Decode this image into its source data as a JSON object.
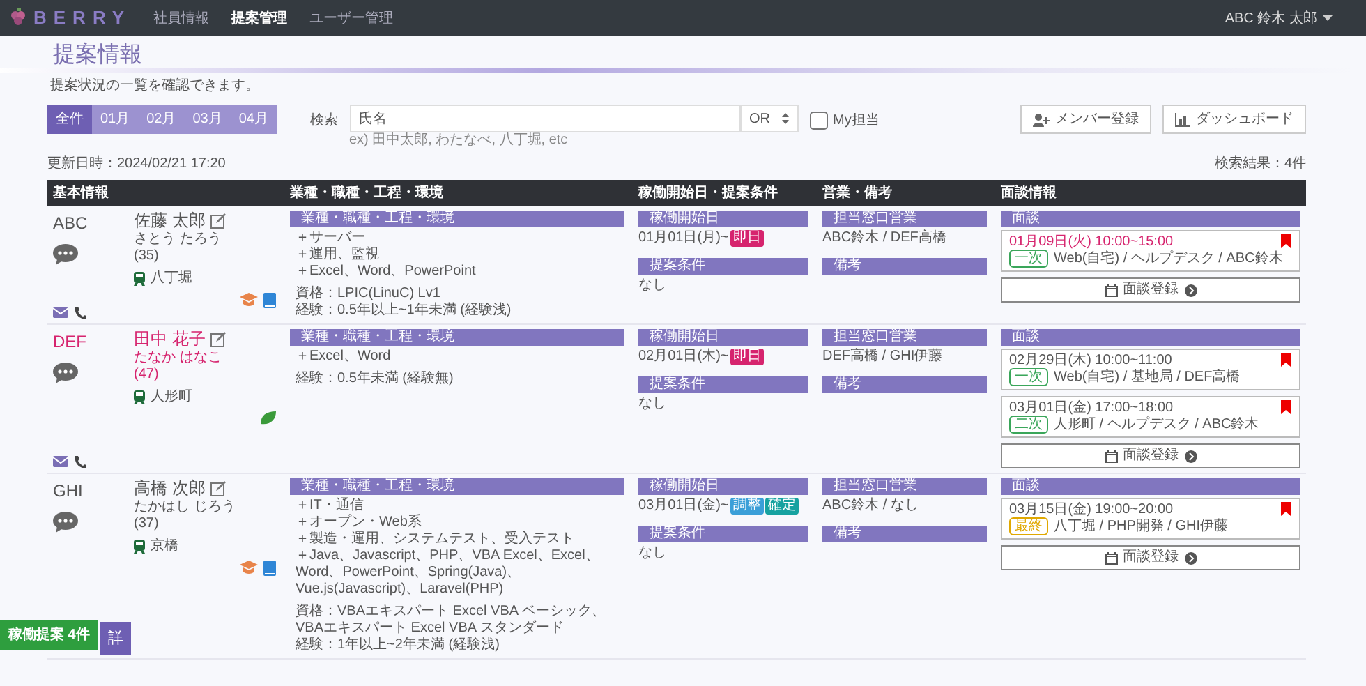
{
  "navbar": {
    "brand": "BERRY",
    "links": [
      {
        "label": "社員情報",
        "selected": false
      },
      {
        "label": "提案管理",
        "selected": true
      },
      {
        "label": "ユーザー管理",
        "selected": false
      }
    ],
    "user": "ABC 鈴木 太郎"
  },
  "page": {
    "title": "提案情報",
    "subtitle": "提案状況の一覧を確認できます。"
  },
  "filters": {
    "months": [
      {
        "label": "全件",
        "selected": true
      },
      {
        "label": "01月",
        "selected": false
      },
      {
        "label": "02月",
        "selected": false
      },
      {
        "label": "03月",
        "selected": false
      },
      {
        "label": "04月",
        "selected": false
      }
    ],
    "search_label": "検索",
    "search": {
      "value": "氏名"
    },
    "operator": "OR",
    "hint": "ex) 田中太郎, わたなべ, 八丁堀, etc",
    "my_only": {
      "label": "My担当",
      "checked": false
    }
  },
  "actions": [
    {
      "label": "メンバー登録",
      "kind": "user"
    },
    {
      "label": "ダッシュボード",
      "kind": "chart"
    }
  ],
  "updated": "更新日時：2024/02/21 17:20",
  "result_count": "検索結果：4件",
  "table": {
    "columns": [
      "基本情報",
      "業種・職種・工程・環境",
      "稼働開始日・提案条件",
      "営業・備考",
      "面談情報"
    ],
    "rows": [
      {
        "code": "ABC",
        "highlight": false,
        "name": "佐藤 太郎",
        "kana": "さとう たろう",
        "age": "(35)",
        "station": "八丁堀",
        "badges": [
          {
            "kind": "cap"
          },
          {
            "kind": "book"
          }
        ],
        "contact": true,
        "skills_label": "業種・職種・工程・環境",
        "skills": [
          "＋サーバー",
          "＋運用、監視",
          "＋Excel、Word、PowerPoint"
        ],
        "notes": [
          {
            "text": "資格：LPIC(LinuC) Lv1"
          },
          {
            "text": "経験：0.5年以上~1年未満",
            "tag": "(経験浅)"
          }
        ],
        "start_label": "稼働開始日",
        "start": "01月01日(月)~",
        "start_tags": [
          {
            "label": "即日",
            "color": "#d6246e"
          }
        ],
        "conditions_label": "提案条件",
        "conditions": "なし",
        "sales_label": "担当窓口営業",
        "sales": "ABC鈴木 / DEF高橋",
        "remarks_label": "備考",
        "interview_label": "面談",
        "interviews": [
          {
            "when": "01月09日(火) 10:00~15:00",
            "urgent": true,
            "stage": {
              "label": "一次",
              "color": "#3aa65a"
            },
            "detail": "Web(自宅) / ヘルプデスク / ABC鈴木",
            "flagged": true
          }
        ],
        "register": "面談登録"
      },
      {
        "code": "DEF",
        "highlight": true,
        "name": "田中 花子",
        "kana": "たなか はなこ",
        "age": "(47)",
        "station": "人形町",
        "badges": [
          {
            "kind": "leaf"
          }
        ],
        "contact": true,
        "skills_label": "業種・職種・工程・環境",
        "skills": [
          "＋Excel、Word"
        ],
        "notes": [
          {
            "text": "経験：0.5年未満",
            "tag": "(経験無)"
          }
        ],
        "start_label": "稼働開始日",
        "start": "02月01日(木)~",
        "start_tags": [
          {
            "label": "即日",
            "color": "#d6246e"
          }
        ],
        "conditions_label": "提案条件",
        "conditions": "なし",
        "sales_label": "担当窓口営業",
        "sales": "DEF高橋 / GHI伊藤",
        "remarks_label": "備考",
        "interview_label": "面談",
        "interviews": [
          {
            "when": "02月29日(木) 10:00~11:00",
            "urgent": false,
            "stage": {
              "label": "一次",
              "color": "#3aa65a"
            },
            "detail": "Web(自宅) / 基地局 / DEF高橋",
            "flagged": true
          },
          {
            "when": "03月01日(金) 17:00~18:00",
            "urgent": false,
            "stage": {
              "label": "二次",
              "color": "#3aa65a"
            },
            "detail": "人形町 / ヘルプデスク / ABC鈴木",
            "flagged": true
          }
        ],
        "register": "面談登録"
      },
      {
        "code": "GHI",
        "highlight": false,
        "name": "高橋 次郎",
        "kana": "たかはし じろう",
        "age": "(37)",
        "station": "京橋",
        "badges": [
          {
            "kind": "cap"
          },
          {
            "kind": "book"
          }
        ],
        "contact": false,
        "skills_label": "業種・職種・工程・環境",
        "skills": [
          "＋IT・通信",
          "＋オープン・Web系",
          "＋製造・運用、システムテスト、受入テスト",
          "＋Java、Javascript、PHP、VBA Excel、Excel、Word、PowerPoint、Spring(Java)、Vue.js(Javascript)、Laravel(PHP)"
        ],
        "notes": [
          {
            "text": "資格：VBAエキスパート Excel VBA ベーシック、VBAエキスパート Excel VBA スタンダード"
          },
          {
            "text": "経験：1年以上~2年未満",
            "tag": "(経験浅)"
          }
        ],
        "start_label": "稼働開始日",
        "start": "03月01日(金)~",
        "start_tags": [
          {
            "label": "調整",
            "color": "#3b9fd8"
          },
          {
            "label": "確定",
            "color": "#17a2a0"
          }
        ],
        "conditions_label": "提案条件",
        "conditions": "なし",
        "sales_label": "担当窓口営業",
        "sales": "ABC鈴木 / なし",
        "remarks_label": "備考",
        "interview_label": "面談",
        "interviews": [
          {
            "when": "03月15日(金) 19:00~20:00",
            "urgent": false,
            "stage": {
              "label": "最終",
              "color": "#e0a800"
            },
            "detail": "八丁堀 / PHP開発 / GHI伊藤",
            "flagged": true
          }
        ],
        "register": "面談登録"
      }
    ]
  },
  "floating": {
    "badge": "稼働提案 4件",
    "button": "詳"
  }
}
